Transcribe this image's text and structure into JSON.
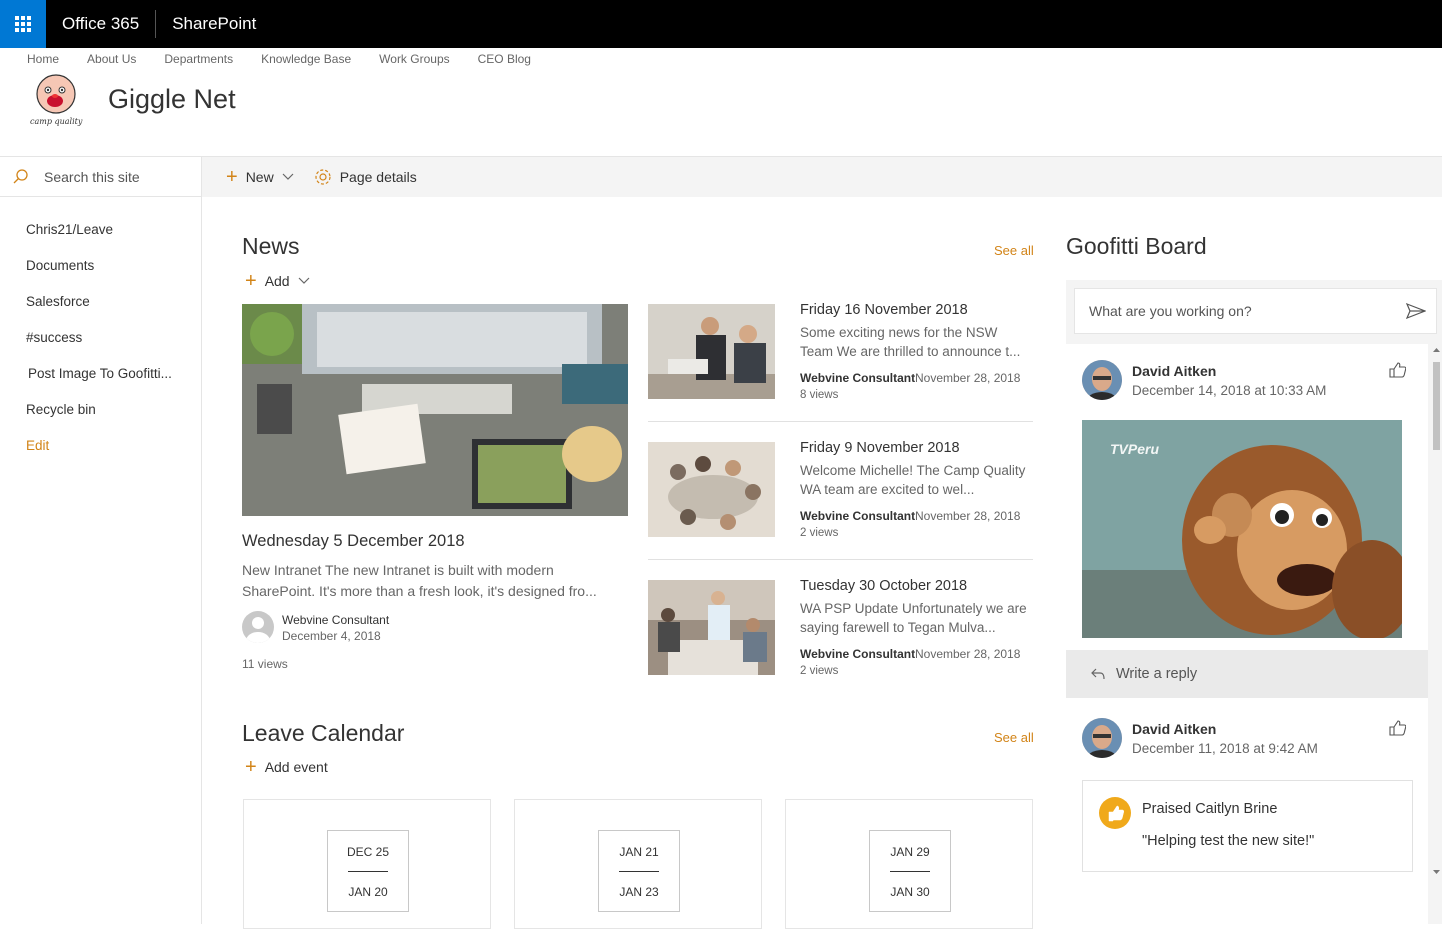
{
  "suitebar": {
    "office": "Office 365",
    "app": "SharePoint"
  },
  "topnav": [
    "Home",
    "About Us",
    "Departments",
    "Knowledge Base",
    "Work Groups",
    "CEO Blog"
  ],
  "site": {
    "title": "Giggle Net",
    "logo_text": "camp quality"
  },
  "search": {
    "placeholder": "Search this site"
  },
  "leftnav": [
    "Chris21/Leave",
    "Documents",
    "Salesforce",
    "#success",
    "Post Image To Goofitti...",
    "Recycle bin"
  ],
  "leftnav_edit": "Edit",
  "commandbar": {
    "new": "New",
    "page_details": "Page details"
  },
  "news": {
    "title": "News",
    "see_all": "See all",
    "add": "Add",
    "hero": {
      "title": "Wednesday 5 December 2018",
      "desc": "New Intranet The new Intranet is built with modern SharePoint. It's more than a fresh look, it's designed fro...",
      "author": "Webvine Consultant",
      "date": "December 4, 2018",
      "views": "11 views"
    },
    "items": [
      {
        "title": "Friday 16 November 2018",
        "desc": "Some exciting news for the NSW Team We are thrilled to announce t...",
        "author": "Webvine Consultant",
        "date": "November 28, 2018",
        "views": "8 views"
      },
      {
        "title": "Friday 9 November 2018",
        "desc": "Welcome Michelle! The Camp Quality WA team are excited to wel...",
        "author": "Webvine Consultant",
        "date": "November 28, 2018",
        "views": "2 views"
      },
      {
        "title": "Tuesday 30 October 2018",
        "desc": "WA PSP Update Unfortunately we are saying farewell to Tegan Mulva...",
        "author": "Webvine Consultant",
        "date": "November 28, 2018",
        "views": "2 views"
      }
    ]
  },
  "calendar": {
    "title": "Leave Calendar",
    "see_all": "See all",
    "add_event": "Add event",
    "events": [
      {
        "start": "DEC 25",
        "end": "JAN 20"
      },
      {
        "start": "JAN 21",
        "end": "JAN 23"
      },
      {
        "start": "JAN 29",
        "end": "JAN 30"
      }
    ]
  },
  "goofitti": {
    "title": "Goofitti Board",
    "compose_placeholder": "What are you working on?",
    "posts": [
      {
        "author": "David Aitken",
        "date": "December 14, 2018 at 10:33 AM",
        "image_caption": "TVPeru"
      },
      {
        "author": "David Aitken",
        "date": "December 11, 2018 at 9:42 AM"
      }
    ],
    "reply": "Write a reply",
    "praise": {
      "title": "Praised Caitlyn Brine",
      "quote": "\"Helping test the new site!\""
    }
  },
  "colors": {
    "accent": "#d28418",
    "suitebar": "#000000",
    "waffle": "#0078d4"
  }
}
